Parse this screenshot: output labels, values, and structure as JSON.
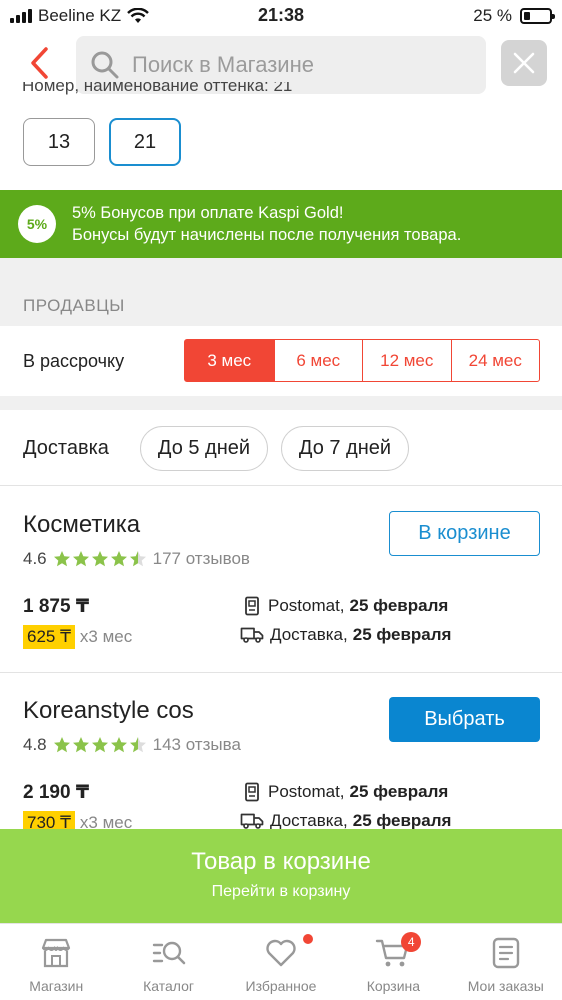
{
  "status_bar": {
    "carrier": "Beeline KZ",
    "time": "21:38",
    "battery": "25 %",
    "battery_level": 0.25
  },
  "header": {
    "search_placeholder": "Поиск в Магазине"
  },
  "shade": {
    "label_cut": "Номер, наименование оттенка: 21",
    "options": [
      "13",
      "21"
    ],
    "selected": "21"
  },
  "bonus": {
    "badge": "5%",
    "line1": "5% Бонусов при оплате Kaspi Gold!",
    "line2": "Бонусы будут начислены после получения товара.",
    "color": "#5daa1b"
  },
  "sellers_section": {
    "title": "ПРОДАВЦЫ",
    "installment_label": "В рассрочку",
    "tenors": [
      "3 мес",
      "6 мес",
      "12 мес",
      "24 мес"
    ],
    "selected_tenor": "3 мес",
    "delivery_label": "Доставка",
    "delivery_filters": [
      "До 5 дней",
      "До 7 дней"
    ]
  },
  "sellers": [
    {
      "name": "Косметика",
      "rating": "4.6",
      "stars": 4.5,
      "reviews": "177 отзывов",
      "button": "В корзине",
      "price": "1 875 ₸",
      "monthly": "625 ₸",
      "monthly_suffix": "x3 мес",
      "postomat_label": "Postomat,",
      "postomat_date": "25 февраля",
      "delivery_label": "Доставка,",
      "delivery_date": "25 февраля"
    },
    {
      "name": "Koreanstyle cos",
      "rating": "4.8",
      "stars": 4.5,
      "reviews": "143 отзыва",
      "button": "Выбрать",
      "price": "2 190 ₸",
      "monthly": "730 ₸",
      "monthly_suffix": "x3 мес",
      "postomat_label": "Postomat,",
      "postomat_date": "25 февраля",
      "delivery_label": "Доставка,",
      "delivery_date": "25 февраля"
    }
  ],
  "cart_bar": {
    "title": "Товар в корзине",
    "subtitle": "Перейти в корзину",
    "color": "#96d74e"
  },
  "tabbar": {
    "items": [
      {
        "label": "Магазин",
        "icon": "shop-icon"
      },
      {
        "label": "Каталог",
        "icon": "catalog-icon"
      },
      {
        "label": "Избранное",
        "icon": "heart-icon"
      },
      {
        "label": "Корзина",
        "icon": "cart-icon",
        "badge": "4"
      },
      {
        "label": "Мои заказы",
        "icon": "orders-icon"
      }
    ]
  },
  "colors": {
    "accent_red": "#f14635",
    "accent_blue": "#1a8ed0",
    "price_tag": "#ffd000",
    "star": "#8bc34a"
  }
}
